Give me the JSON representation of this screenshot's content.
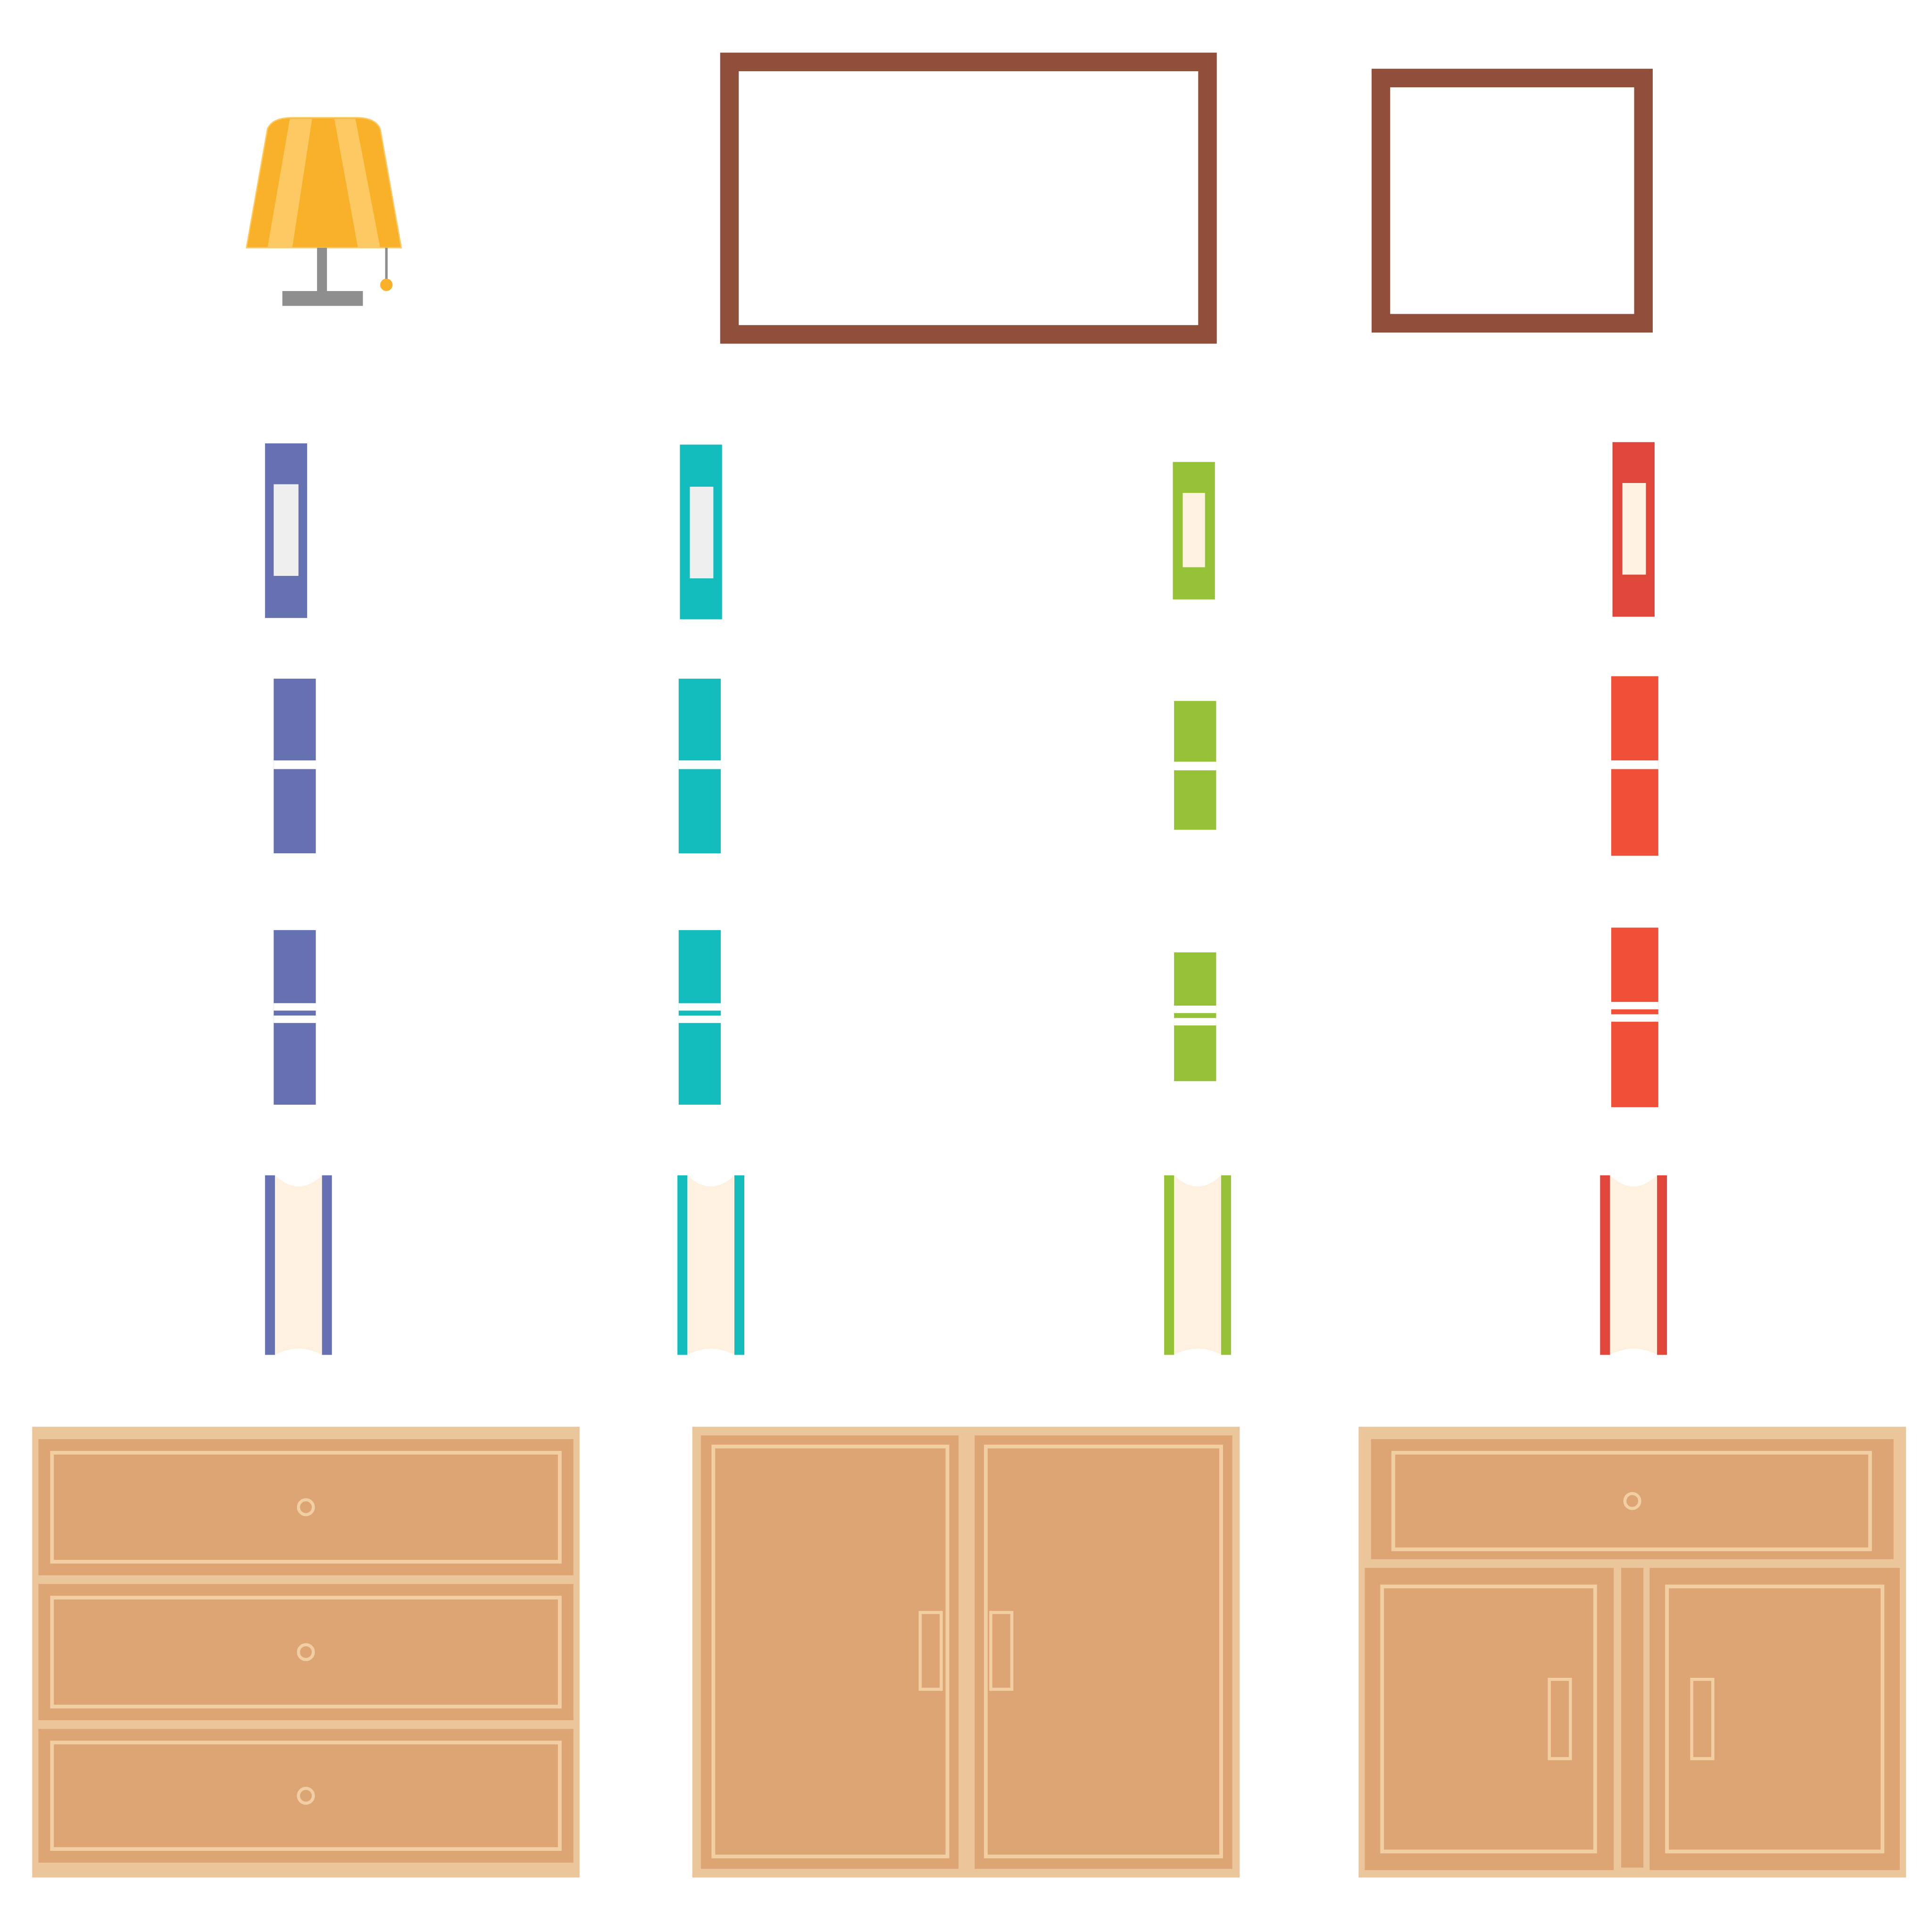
{
  "colors": {
    "background": "#ffffff",
    "lamp_shade": "#f9b12a",
    "lamp_shade_stripe": "#fcc962",
    "lamp_metal": "#8e8e8e",
    "frame": "#8f4f3a",
    "book_blue": "#6571b0",
    "book_teal": "#13bdbd",
    "book_green": "#96c237",
    "book_red": "#e0463a",
    "book_red_light": "#f05038",
    "label_light": "#f0f0f0",
    "label_cream": "#fdf2df",
    "pages": "#fff1df",
    "wood": "#dea574",
    "wood_trim": "#ecc69b",
    "wood_line": "#f2cfa2"
  },
  "items": {
    "lamp": "table-lamp",
    "frames": [
      "wide-picture-frame",
      "small-picture-frame"
    ],
    "book_colors": [
      "book_blue",
      "book_teal",
      "book_green",
      "book_red"
    ],
    "book_styles": [
      "label-spine",
      "single-band-spine",
      "double-band-spine",
      "open-pages"
    ],
    "furniture": [
      "three-drawer-chest",
      "two-door-cabinet",
      "drawer-and-door-cabinet"
    ]
  }
}
